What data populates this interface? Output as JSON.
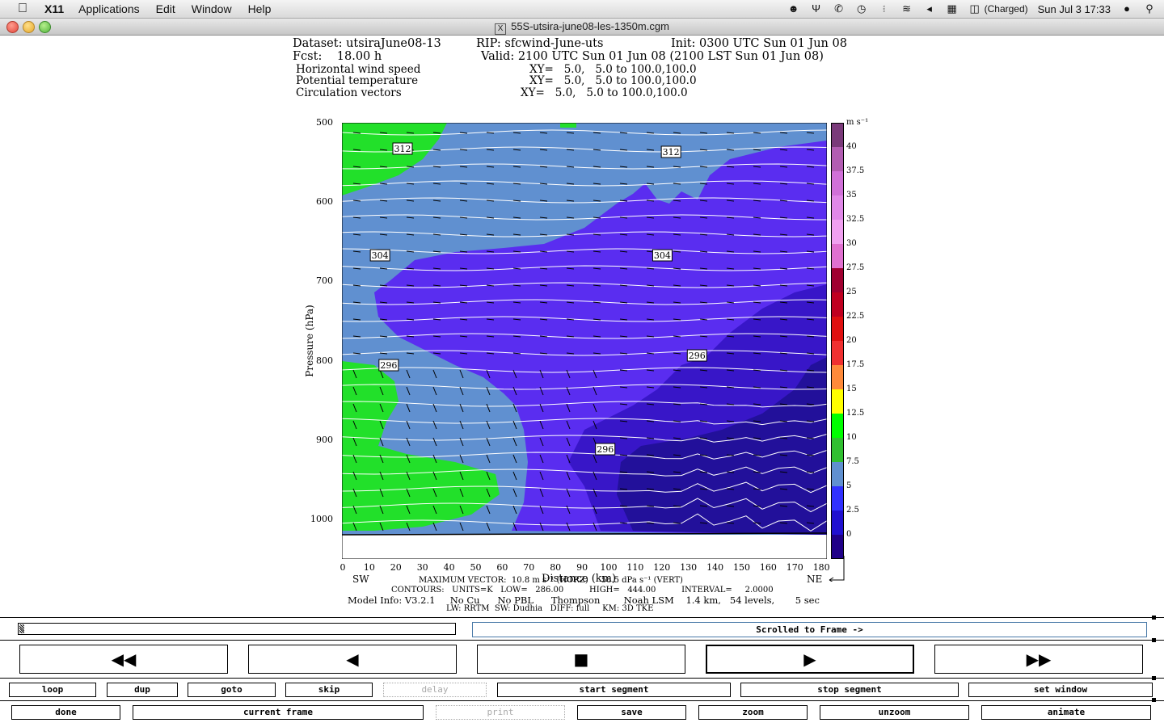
{
  "menubar": {
    "app_name": "X11",
    "items": [
      "Applications",
      "Edit",
      "Window",
      "Help"
    ],
    "battery": "(Charged)",
    "clock": "Sun Jul 3  17:33"
  },
  "window": {
    "title": "55S-utsira-june08-les-1350m.cgm"
  },
  "plot": {
    "header": {
      "dataset": "Dataset: utsiraJune08-13",
      "rip": "RIP: sfcwind-June-uts",
      "init": "Init: 0300 UTC Sun 01 Jun 08",
      "fcst": "Fcst:    18.00 h",
      "valid": "Valid: 2100 UTC Sun 01 Jun 08 (2100 LST Sun 01 Jun 08)",
      "field1": "Horizontal wind speed",
      "field1_xy": "XY=   5.0,   5.0 to 100.0,100.0",
      "field2": "Potential temperature",
      "field2_xy": "XY=   5.0,   5.0 to 100.0,100.0",
      "field3": "Circulation vectors",
      "field3_xy": "XY=   5.0,   5.0 to 100.0,100.0"
    },
    "y_label": "Pressure (hPa)",
    "y_ticks": [
      "500",
      "600",
      "700",
      "800",
      "900",
      "1000"
    ],
    "x_label": "Distance (km)",
    "x_ticks": [
      "0",
      "10",
      "20",
      "30",
      "40",
      "50",
      "60",
      "70",
      "80",
      "90",
      "100",
      "110",
      "120",
      "130",
      "140",
      "150",
      "160",
      "170",
      "180"
    ],
    "sw_label": "SW",
    "ne_label": "NE",
    "contour_labels": [
      {
        "text": "312",
        "x": 35,
        "y": 8
      },
      {
        "text": "312",
        "x": 190,
        "y": 9
      },
      {
        "text": "304",
        "x": 22,
        "y": 41
      },
      {
        "text": "304",
        "x": 185,
        "y": 41
      },
      {
        "text": "296",
        "x": 27,
        "y": 75
      },
      {
        "text": "296",
        "x": 205,
        "y": 72
      },
      {
        "text": "296",
        "x": 152,
        "y": 101
      }
    ],
    "colorbar": {
      "units": "m s⁻¹",
      "ticks": [
        "40",
        "37.5",
        "35",
        "32.5",
        "30",
        "27.5",
        "25",
        "22.5",
        "20",
        "17.5",
        "15",
        "12.5",
        "10",
        "7.5",
        "5",
        "2.5",
        "0"
      ],
      "colors": [
        "#7a3a7a",
        "#b25db2",
        "#d070d8",
        "#e088e8",
        "#f0a0f0",
        "#e070d0",
        "#a00030",
        "#c00020",
        "#e01010",
        "#f03030",
        "#ff8a3a",
        "#ffff00",
        "#00ff00",
        "#30c030",
        "#6090d0",
        "#3030ff",
        "#2010d0",
        "#200088"
      ]
    },
    "footer": {
      "max_vector": "MAXIMUM VECTOR:  10.8 m s⁻¹ (HORZ)     58.5 dPa s⁻¹ (VERT)",
      "contours": "CONTOURS:   UNITS=K   LOW=   286.00          HIGH=   444.00          INTERVAL=     2.0000",
      "model_info": "Model Info: V3.2.1     No Cu      No PBL      Thompson        Noah LSM    1.4 km,   54 levels,       5 sec",
      "physics": "LW: RRTM  SW: Dudhia   DIFF: full     KM: 3D TKE"
    },
    "colors": {
      "green": "#22e02a",
      "steel": "#6090d0",
      "violet": "#5a2df0",
      "indigo": "#3816c8",
      "deep": "#22109a"
    }
  },
  "controls": {
    "frame_status": "Scrolled to Frame ->",
    "nav": [
      {
        "name": "rewind-button",
        "symbol": "◀◀"
      },
      {
        "name": "step-back-button",
        "symbol": "◀"
      },
      {
        "name": "stop-button",
        "symbol": "■"
      },
      {
        "name": "play-button",
        "symbol": "▶"
      },
      {
        "name": "fast-forward-button",
        "symbol": "▶▶"
      }
    ],
    "row1": [
      "loop",
      "dup",
      "goto",
      "skip",
      "delay",
      "start segment",
      "stop segment",
      "set window"
    ],
    "row2": [
      "done",
      "current frame",
      "print",
      "save",
      "zoom",
      "unzoom",
      "animate"
    ]
  }
}
